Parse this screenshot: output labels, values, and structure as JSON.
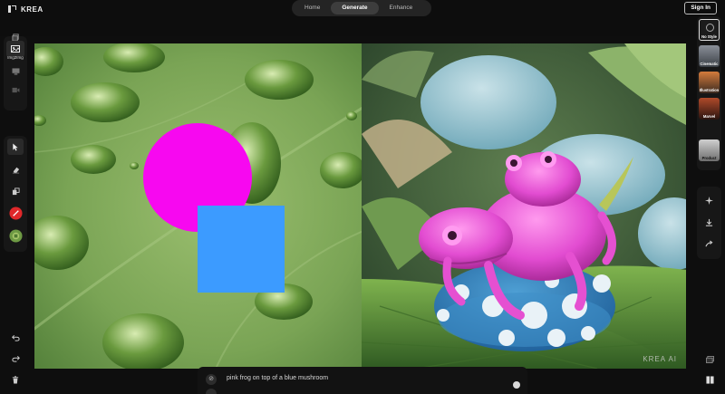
{
  "brand": {
    "name": "KREA"
  },
  "nav": {
    "tabs": [
      "Home",
      "Generate",
      "Enhance"
    ],
    "active": "Generate"
  },
  "header": {
    "signin_label": "Sign In"
  },
  "left_tools": {
    "mode_label": "Img2Img"
  },
  "styles": [
    "No Style",
    "Cinematic",
    "Illustration",
    "Marvel",
    "Product"
  ],
  "prompt": {
    "text": "pink frog on top of a blue mushroom"
  },
  "watermark": "KREA AI",
  "colors": {
    "circle": "#f708f0",
    "square": "#3c9bff",
    "accent": "#ffffff"
  }
}
